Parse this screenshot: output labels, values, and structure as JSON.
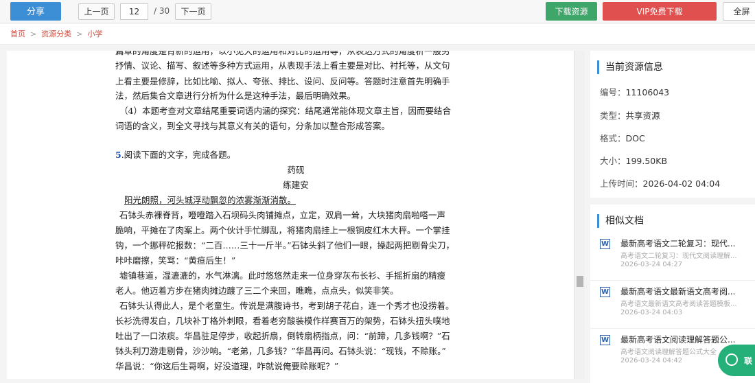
{
  "toolbar": {
    "share_label": "分享",
    "prev_label": "上一页",
    "page_current": "12",
    "page_total": "/ 30",
    "next_label": "下一页",
    "download_label": "下载资源",
    "vip_label": "VIP免费下载",
    "fullscreen_label": "全屏"
  },
  "breadcrumb": [
    "首页",
    "资源分类",
    "小学"
  ],
  "document": {
    "lines_top": [
      "篇章的角度是肯新的运用，以小见大的运用和对比的运用等，从表达方式的角度析一般另",
      "抒情、议论、描写、叙述等多种方式运用，从表现手法上看主要是对比、衬托等，从文句",
      "上看主要是修辞，比如比喻、拟人、夸张、排比、设问、反问等。答题时注意首先明确手",
      "法，然后集合文章进行分析为什么是这种手法，最后明确效果。",
      "（4）本题考查对文章结尾重要词语内涵的探究：结尾通常能体现文章主旨，因而要结合",
      "词语的含义，到全文寻找与其意义有关的语句，分条加以整合形成答案。"
    ],
    "question_num": "5",
    "question_text": ".阅读下面的文字，完成各题。",
    "essay_title": "药砚",
    "essay_author": "练建安",
    "underlined_sentence": "阳光朗照，河头城浮动飘忽的浓雾渐渐消散。",
    "lines_body": [
      "石钵头赤裸脊背，噔噔踏入石坝码头肉铺摊点，立定，双肩一耸，大块猪肉扇啪嗒一声",
      "脆响，平摊在了肉案上。两个伙计手忙脚乱，将猪肉扇挂上一根铜皮红木大秤。一个掌挂",
      "钩，一个挪秤砣报数：“二百……三十一斤半。”石钵头斜了他们一眼，操起两把剔骨尖刀，",
      "咔咔磨擦，笑骂：“黄疸后生！”",
      "墟镇巷道，湿漉漉的，水气淋漓。此时悠悠然走来一位身穿灰布长衫、手摇折扇的精瘦",
      "老人。他迈着方步在猪肉摊边踱了三二个来回，瞧瞧，点点头，似笑非笑。",
      "石钵头认得此人，是个老童生。传说是满腹诗书，考到胡子花白，连一个秀才也没捞着。",
      "长衫洗得发白，几块补丁格外刺眼，看着老穷酸装模作样赛百万的架势，石钵头扭头噗地",
      "吐出了一口浓痰。华昌驻足停步，收起折扇，倒转扇柄指点，问：“前蹄，几多钱啊？”石",
      "钵头利刀游走剔骨，沙沙响。“老弟，几多钱？”华昌再问。石钵头说：“现钱，不赊账。”",
      "华昌说：“你这后生哥啊，好没道理，咋就说俺要赊账呢？”"
    ]
  },
  "resource_info": {
    "title": "当前资源信息",
    "rows": [
      {
        "label": "编号：",
        "value": "11106043"
      },
      {
        "label": "类型：",
        "value": "共享资源"
      },
      {
        "label": "格式：",
        "value": "DOC"
      },
      {
        "label": "大小：",
        "value": "199.50KB"
      },
      {
        "label": "上传时间：",
        "value": "2026-04-02 04:04"
      }
    ]
  },
  "similar_docs": {
    "title": "相似文档",
    "items": [
      {
        "icon": "W",
        "title": "最新高考语文二轮复习：现代...",
        "desc": "高考语文二轮复习：现代文阅读理解...",
        "date": "2026-03-24 04:27"
      },
      {
        "icon": "W",
        "title": "最新高考语文最新语文高考阅...",
        "desc": "高考语文最新语文高考阅读答题模板...",
        "date": "2026-03-24 04:03"
      },
      {
        "icon": "W",
        "title": "最新高考语文阅读理解答题公...",
        "desc": "高考语文阅读理解答题公式大全",
        "date": "2026-03-24 04:42"
      }
    ]
  },
  "chat": {
    "label": "联"
  }
}
